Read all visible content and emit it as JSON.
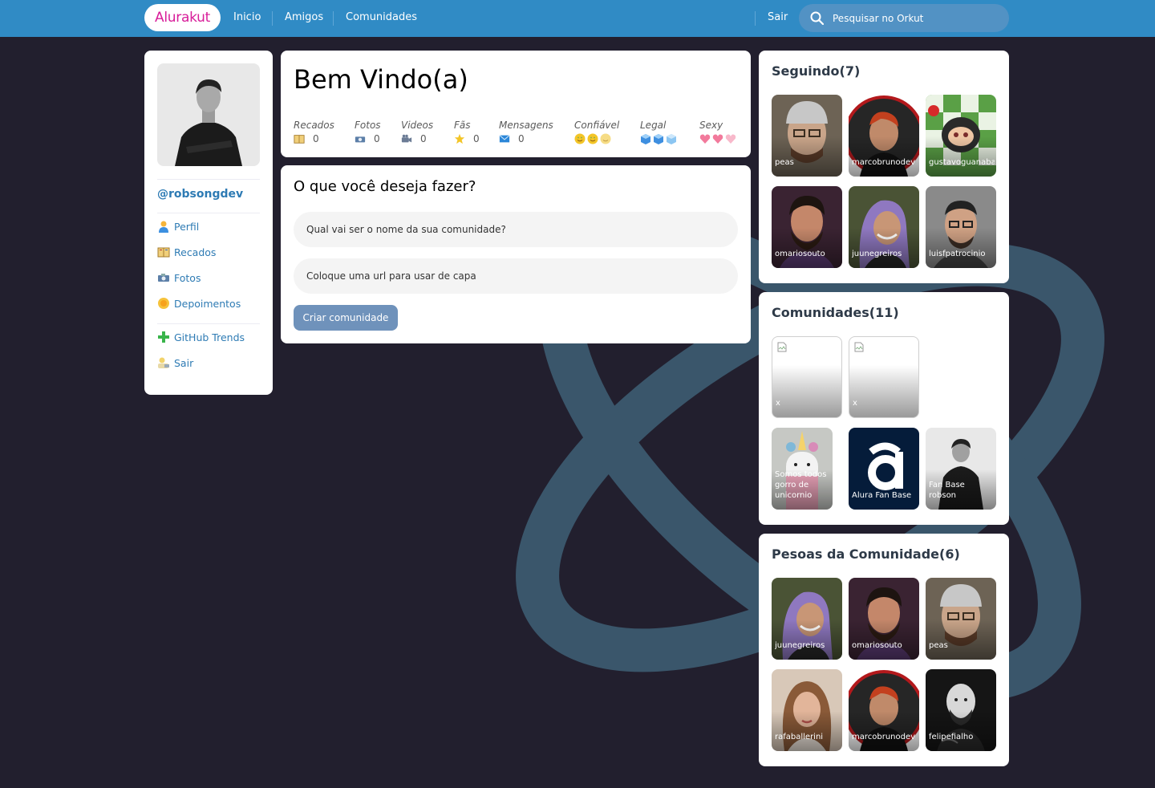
{
  "app": {
    "logo": "Alurakut",
    "nav": [
      "Inicio",
      "Amigos",
      "Comunidades"
    ],
    "logout": "Sair",
    "search_placeholder": "Pesquisar no Orkut"
  },
  "sidebar": {
    "username": "@robsongdev",
    "items": [
      {
        "label": "Perfil",
        "icon": "user-icon"
      },
      {
        "label": "Recados",
        "icon": "book-icon"
      },
      {
        "label": "Fotos",
        "icon": "camera-icon"
      },
      {
        "label": "Depoimentos",
        "icon": "sun-icon"
      },
      {
        "label": "GitHub Trends",
        "icon": "plus-icon"
      },
      {
        "label": "Sair",
        "icon": "logout-icon"
      }
    ]
  },
  "welcome": {
    "title": "Bem Vindo(a)",
    "stats": [
      {
        "label": "Recados",
        "value": "0",
        "icon": "book-icon"
      },
      {
        "label": "Fotos",
        "value": "0",
        "icon": "camera-icon"
      },
      {
        "label": "Videos",
        "value": "0",
        "icon": "video-camera-icon"
      },
      {
        "label": "Fãs",
        "value": "0",
        "icon": "star-icon"
      },
      {
        "label": "Mensagens",
        "value": "0",
        "icon": "envelope-icon"
      }
    ],
    "ratings": [
      {
        "label": "Confiável",
        "icon": "smiley-icon",
        "level": 3
      },
      {
        "label": "Legal",
        "icon": "ice-cube-icon",
        "level": 3
      },
      {
        "label": "Sexy",
        "icon": "heart-icon",
        "level": 3
      }
    ]
  },
  "form": {
    "heading": "O que você deseja fazer?",
    "name_placeholder": "Qual vai ser o nome da sua comunidade?",
    "url_placeholder": "Coloque uma url para usar de capa",
    "submit": "Criar comunidade"
  },
  "following": {
    "title": "Seguindo(7)",
    "people": [
      "peas",
      "marcobrunodev",
      "gustavoguanabara",
      "omariosouto",
      "juunegreiros",
      "luisfpatrocinio"
    ]
  },
  "communities": {
    "title": "Comunidades(11)",
    "items": [
      "x",
      "x",
      "Somos todos gorro de unicornio",
      "Alura Fan Base",
      "Fan Base robson"
    ]
  },
  "members": {
    "title": "Pesoas da Comunidade(6)",
    "people": [
      "juunegreiros",
      "omariosouto",
      "peas",
      "rafaballerini",
      "marcobrunodev",
      "felipefialho"
    ]
  },
  "colors": {
    "topbar": "#308bc5",
    "background": "#221f2e",
    "logo_text": "#d81d99",
    "link": "#2e7bb4",
    "button": "#6f92bb"
  }
}
